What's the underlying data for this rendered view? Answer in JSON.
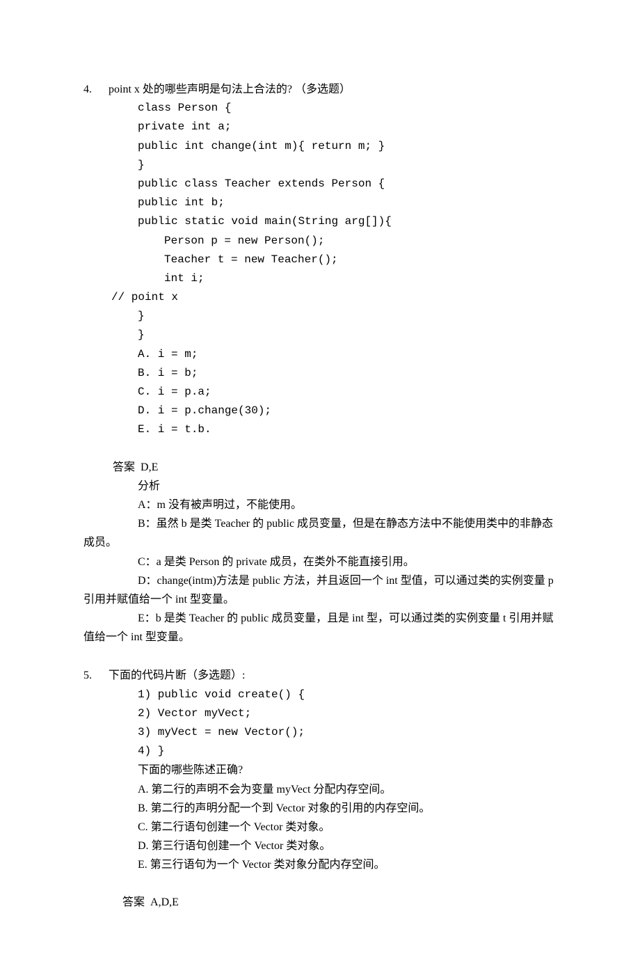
{
  "q4": {
    "number": "4.",
    "prompt": "point x 处的哪些声明是句法上合法的? （多选题）",
    "code": {
      "l1": "class Person {",
      "l2": "private int a;",
      "l3": "public int change(int m){ return m; }",
      "l4": "}",
      "l5": "public class Teacher extends Person {",
      "l6": "public int b;",
      "l7": "public static void main(String arg[]){",
      "l8": "Person p = new Person();",
      "l9": "Teacher t = new Teacher();",
      "l10": "int i;",
      "l11": "// point x",
      "l12": "}",
      "l13": "}"
    },
    "options": {
      "a": "A. i = m;",
      "b": "B. i = b;",
      "c": "C. i = p.a;",
      "d": "D. i = p.change(30);",
      "e": "E. i = t.b."
    },
    "answer_label": "答案",
    "answer_value": "D,E",
    "analysis": {
      "heading": "分析",
      "a": "A：m 没有被声明过，不能使用。",
      "b": "B：虽然 b 是类 Teacher 的 public 成员变量，但是在静态方法中不能使用类中的非静态成员。",
      "c": "C：a 是类 Person 的 private 成员，在类外不能直接引用。",
      "d": "D：change(intm)方法是 public 方法，并且返回一个 int 型值，可以通过类的实例变量 p 引用并赋值给一个 int 型变量。",
      "e": "E：b 是类 Teacher 的 public 成员变量，且是 int 型，可以通过类的实例变量 t 引用并赋值给一个 int 型变量。"
    }
  },
  "q5": {
    "number": "5.",
    "prompt": "下面的代码片断（多选题）:",
    "code": {
      "l1": "1) public void create() {",
      "l2": "2) Vector myVect;",
      "l3": "3) myVect = new Vector();",
      "l4": "4) }"
    },
    "subprompt": "下面的哪些陈述正确?",
    "options": {
      "a": "A. 第二行的声明不会为变量 myVect 分配内存空间。",
      "b": "B. 第二行的声明分配一个到 Vector 对象的引用的内存空间。",
      "c": "C. 第二行语句创建一个 Vector 类对象。",
      "d": "D. 第三行语句创建一个 Vector 类对象。",
      "e": "E. 第三行语句为一个 Vector 类对象分配内存空间。"
    },
    "answer_label": "答案",
    "answer_value": "A,D,E"
  }
}
